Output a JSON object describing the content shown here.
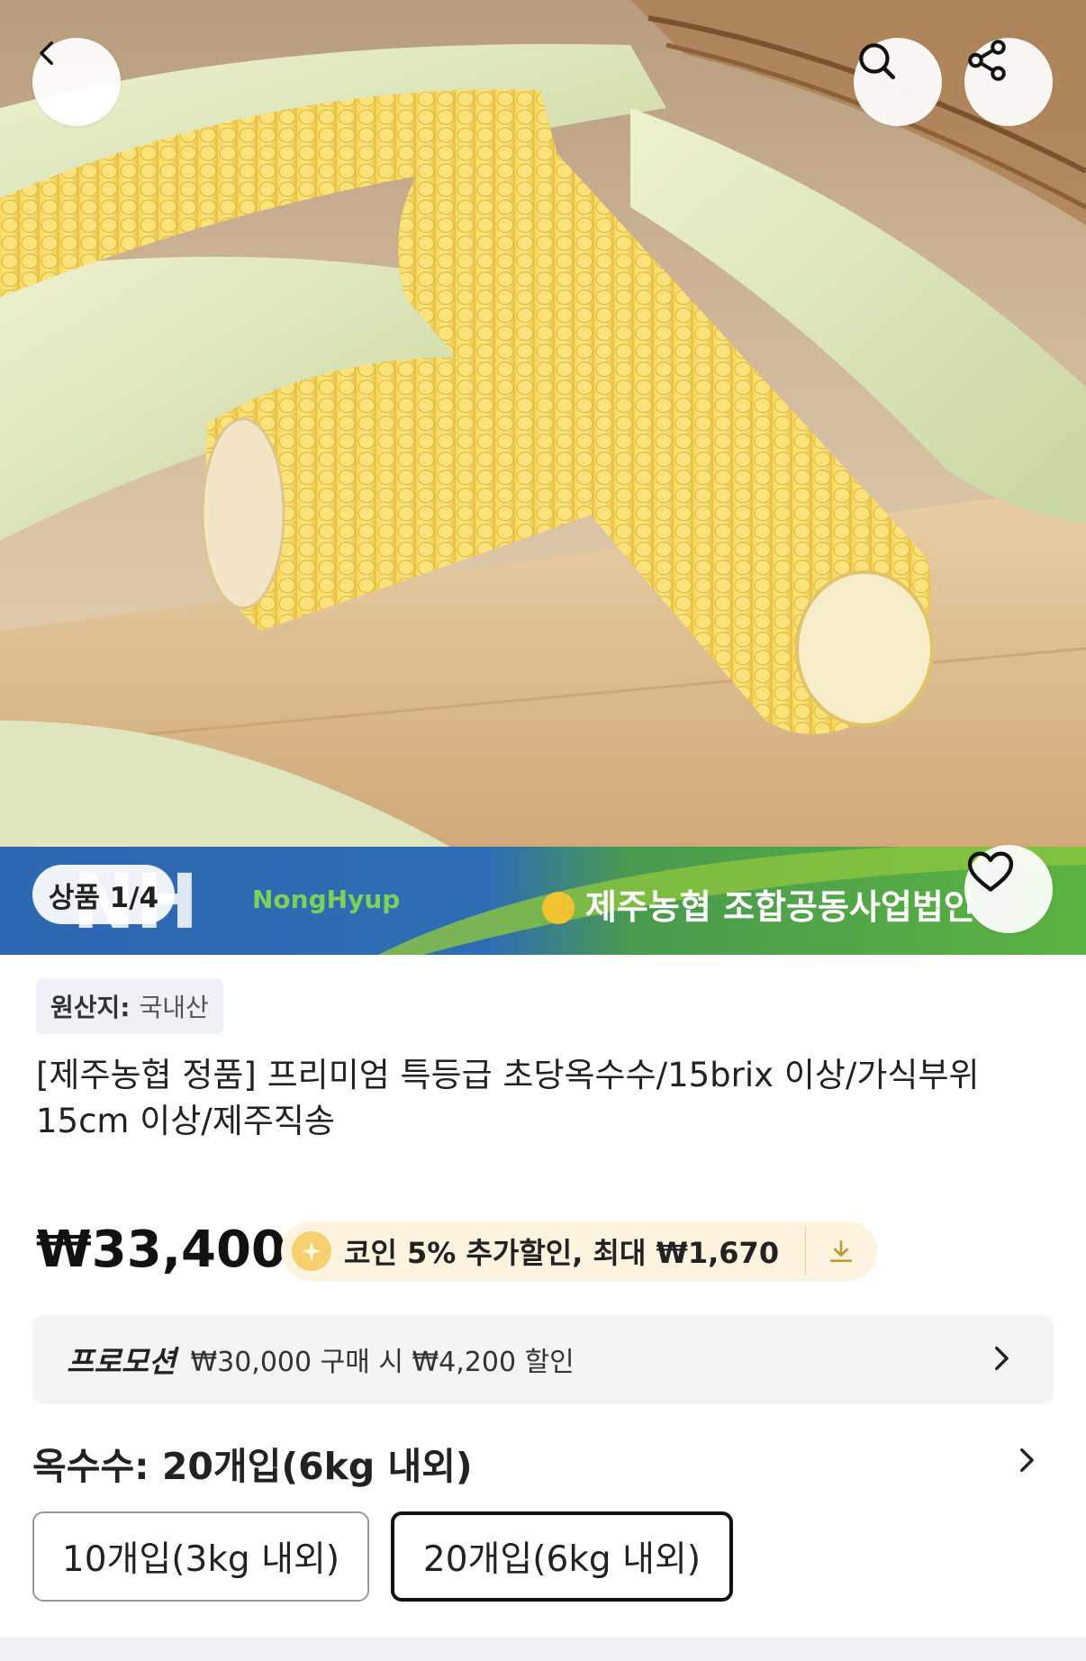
{
  "gallery": {
    "counter": "상품 1/4",
    "banner_logo_text": "NongHyup",
    "banner_logo_mark": "NH",
    "banner_org": "제주농협 조합공동사업법인"
  },
  "header": {
    "back_icon": "chevron-left-icon",
    "search_icon": "search-icon",
    "share_icon": "share-icon",
    "wishlist_icon": "heart-icon"
  },
  "product": {
    "origin_label": "원산지:",
    "origin_value": "국내산",
    "title": "[제주농협 정품] 프리미엄 특등급 초당옥수수/15brix 이상/가식부위 15cm 이상/제주직송",
    "price": "₩33,400",
    "coin_text": "코인 5% 추가할인, 최대 ₩1,670"
  },
  "promotion": {
    "tag": "프로모션",
    "text": "₩30,000 구매 시 ₩4,200 할인"
  },
  "options": {
    "title": "옥수수: 20개입(6kg 내외)",
    "items": [
      {
        "label": "10개입(3kg 내외)",
        "selected": false
      },
      {
        "label": "20개입(6kg 내외)",
        "selected": true
      }
    ]
  },
  "colors": {
    "banner_blue": "#2f6db5",
    "banner_green": "#5ab03e",
    "coin_bg": "#fdf3de"
  }
}
